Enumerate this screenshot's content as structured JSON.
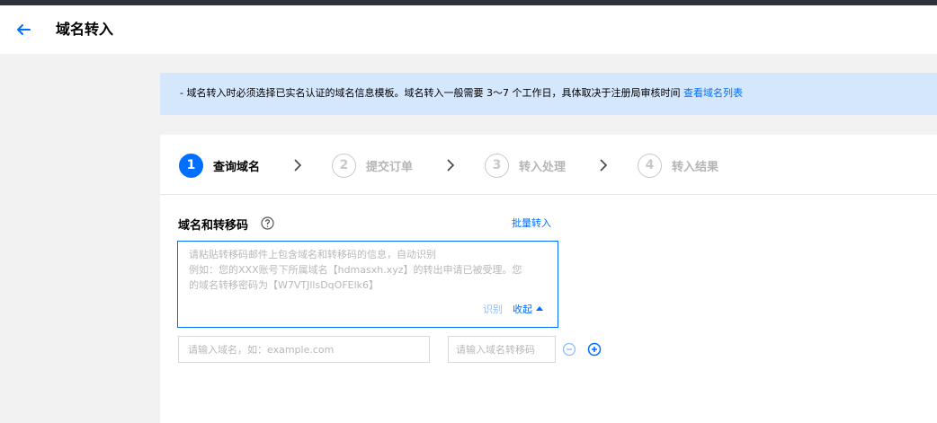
{
  "header": {
    "title": "域名转入",
    "back_icon": "arrow-left-icon"
  },
  "notice": {
    "text": "- 域名转入时必须选择已实名认证的域名信息模板。域名转入一般需要 3～7 个工作日，具体取决于注册局审核时间",
    "link": "查看域名列表"
  },
  "steps": [
    {
      "num": "1",
      "label": "查询域名",
      "active": true
    },
    {
      "num": "2",
      "label": "提交订单",
      "active": false
    },
    {
      "num": "3",
      "label": "转入处理",
      "active": false
    },
    {
      "num": "4",
      "label": "转入结果",
      "active": false
    }
  ],
  "form": {
    "label": "域名和转移码",
    "batch_link": "批量转入",
    "paste_placeholder_lines": [
      "请粘贴转移码邮件上包含域名和转移码的信息，自动识别",
      "例如：您的XXX账号下所属域名【hdmasxh.xyz】的转出申请已被受理。您",
      "的域名转移密码为【W7VTJllsDqOFElk6】"
    ],
    "recognize": "识别",
    "collapse": "收起",
    "domain_placeholder": "请输入域名，如：example.com",
    "code_placeholder": "请输入域名转移码"
  },
  "colors": {
    "accent": "#006eff",
    "notice_bg": "#d5e7fd",
    "page_bg": "#f2f2f2",
    "topbar": "#2e323b"
  }
}
